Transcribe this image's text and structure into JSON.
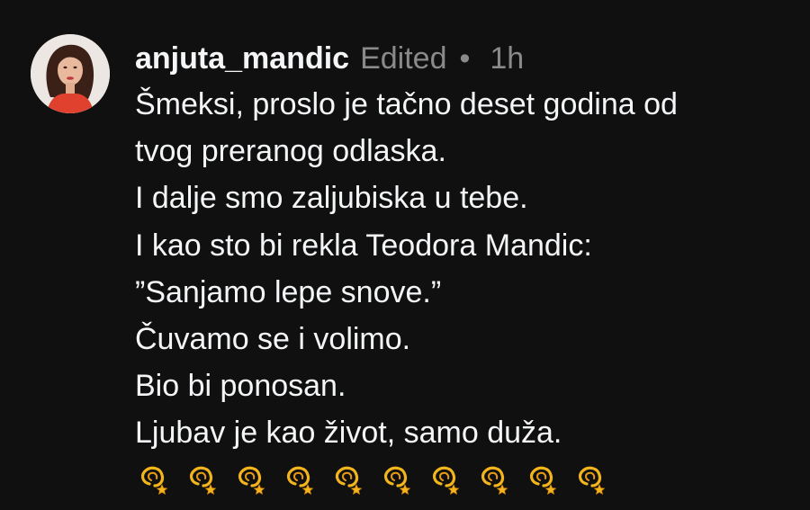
{
  "comment": {
    "username": "anjuta_mandic",
    "edited_label": "Edited",
    "separator": "•",
    "time": "1h",
    "lines": [
      "Šmeksi, proslo je tačno deset godina od",
      "tvog preranog odlaska.",
      "I dalje smo zaljubiska u tebe.",
      "I kao sto bi rekla Teodora Mandic:",
      "”Sanjamo lepe snove.”",
      "Čuvamo se i volimo.",
      "Bio bi ponosan.",
      "Ljubav je kao život, samo duža."
    ],
    "emoji_count": 10,
    "emoji_icon": "dizzy-icon",
    "colors": {
      "background": "#101010",
      "text": "#f3f5f7",
      "muted": "#8a8a8a",
      "emoji": "#f2b51c"
    }
  }
}
